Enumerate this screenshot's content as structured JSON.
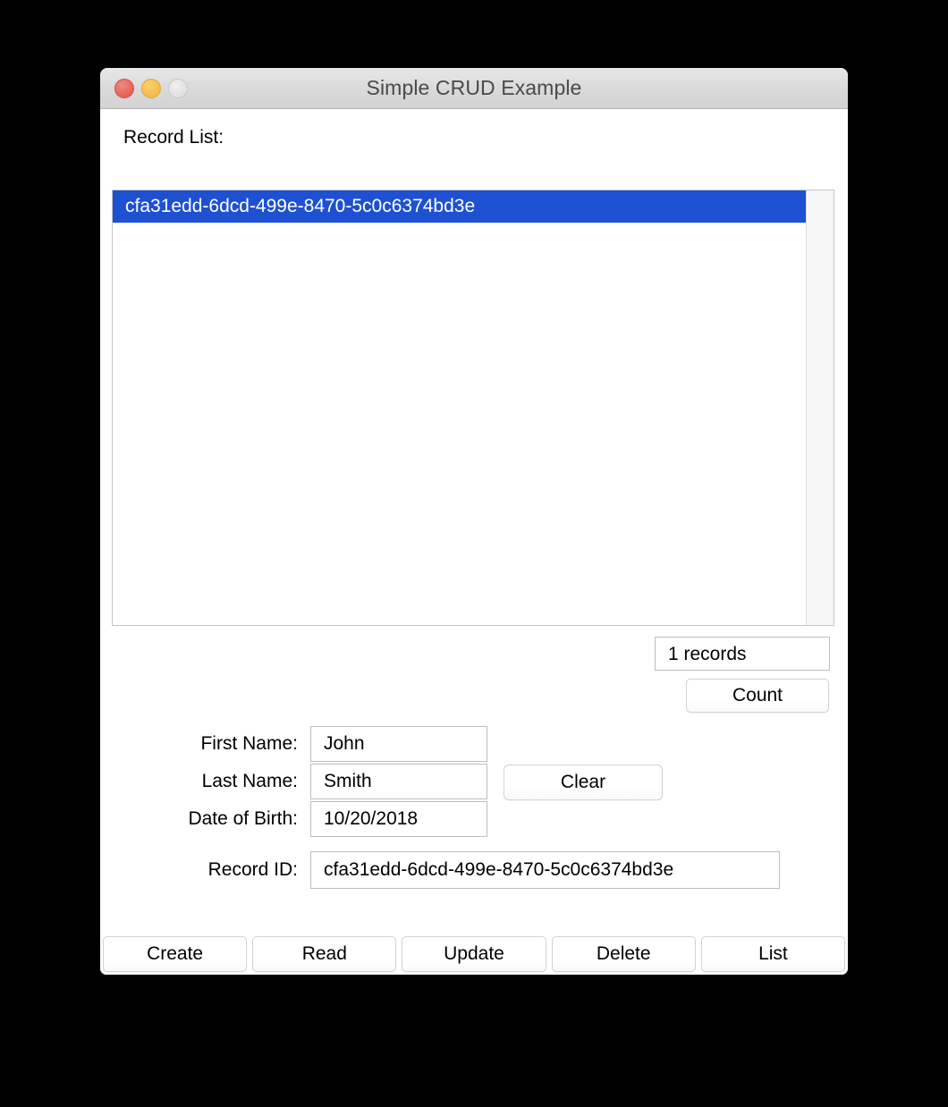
{
  "window": {
    "title": "Simple CRUD Example",
    "traffic_lights": [
      {
        "name": "close",
        "color": "#e8645b"
      },
      {
        "name": "minimize",
        "color": "#f5bd4f"
      },
      {
        "name": "zoom",
        "color": "#e2e2e2"
      }
    ]
  },
  "record_list": {
    "label": "Record List:",
    "items": [
      {
        "text": "cfa31edd-6dcd-499e-8470-5c0c6374bd3e",
        "selected": true
      }
    ],
    "selection_color": "#1e50d2"
  },
  "count": {
    "field_value": "1 records",
    "button_label": "Count"
  },
  "form": {
    "fields": [
      {
        "label": "First Name:",
        "value": "John"
      },
      {
        "label": "Last Name:",
        "value": "Smith"
      },
      {
        "label": "Date of Birth:",
        "value": "10/20/2018"
      }
    ],
    "clear_label": "Clear",
    "record_id": {
      "label": "Record ID:",
      "value": "cfa31edd-6dcd-499e-8470-5c0c6374bd3e"
    }
  },
  "actions": [
    {
      "label": "Create"
    },
    {
      "label": "Read"
    },
    {
      "label": "Update"
    },
    {
      "label": "Delete"
    },
    {
      "label": "List"
    }
  ]
}
